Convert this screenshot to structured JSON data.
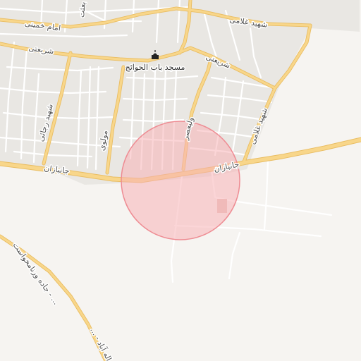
{
  "map": {
    "colors": {
      "background": "#f6f4f1",
      "urban_area": "#e9e7e3",
      "minor_road": "#ffffff",
      "minor_road_casing": "#dedad3",
      "major_road": "#f8d68a",
      "major_road_casing": "#e9bd62",
      "circle_fill": "#f7b3b7",
      "circle_stroke": "#ee8c93",
      "building": "#e6c3bd"
    },
    "search_area": {
      "shape": "circle",
      "opacity": 0.55
    },
    "poi": {
      "icon": "mosque-icon",
      "label": "مسجد باب الحوائج"
    },
    "road_labels": [
      {
        "key": "shahid_gholami_top",
        "text": "شهید غلامی"
      },
      {
        "key": "emam_khomeini",
        "text": "امام خمینی"
      },
      {
        "key": "shariati_left",
        "text": "شریعتی"
      },
      {
        "key": "shariati_right",
        "text": "شریعتی"
      },
      {
        "key": "besat",
        "text": "بعثت"
      },
      {
        "key": "shahid_rajaei",
        "text": "شهید رجائی"
      },
      {
        "key": "molavi",
        "text": "مولوی"
      },
      {
        "key": "valiasr",
        "text": "ولیعصر"
      },
      {
        "key": "shahid_gholami_right",
        "text": "شهید غلامی"
      },
      {
        "key": "janbazan_left",
        "text": "جانبازان"
      },
      {
        "key": "janbazan_right",
        "text": "جانبازان"
      },
      {
        "key": "jadde_varnamkhast",
        "text": "جاده ورنامخواست - ..."
      },
      {
        "key": "allahabad",
        "text": "... - اله آباد"
      }
    ]
  }
}
